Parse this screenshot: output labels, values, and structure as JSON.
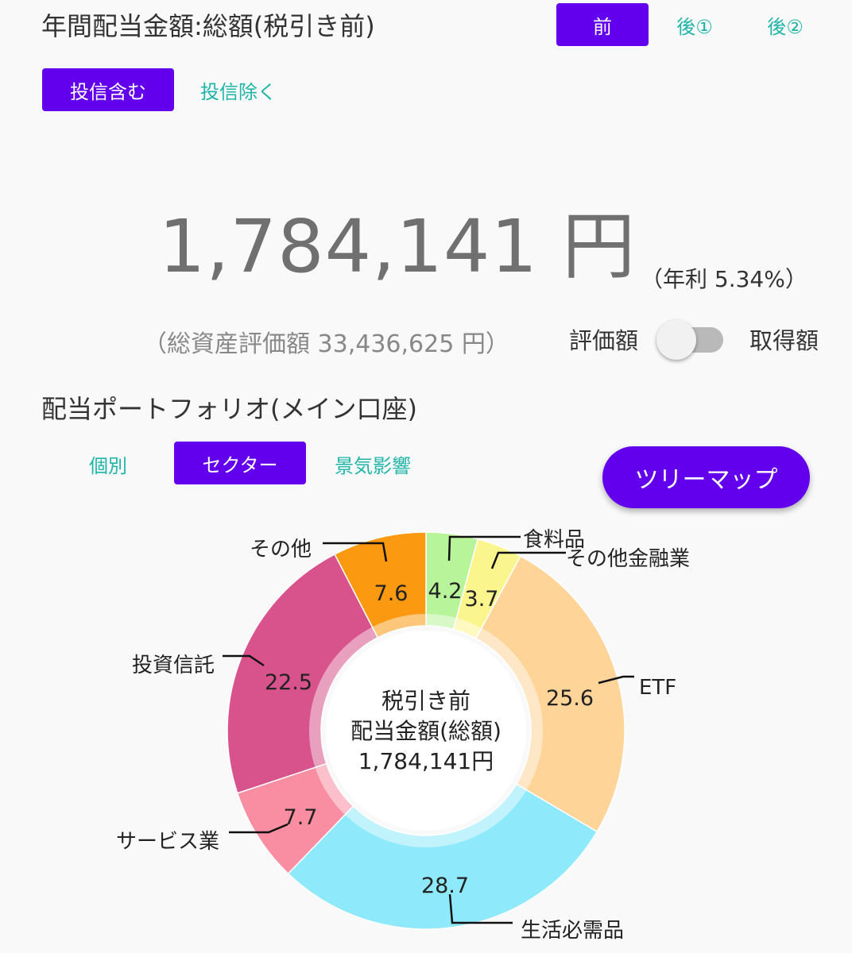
{
  "header": {
    "title": "年間配当金額:総額(税引き前)",
    "tax_tabs": [
      "前",
      "後①",
      "後②"
    ],
    "fund_tabs": [
      "投信含む",
      "投信除く"
    ]
  },
  "summary": {
    "amount": "1,784,141 円",
    "rate": "（年利 5.34%）",
    "total_assets": "（総資産評価額 33,436,625 円）",
    "toggle_left": "評価額",
    "toggle_right": "取得額"
  },
  "portfolio": {
    "title": "配当ポートフォリオ(メイン口座)",
    "view_tabs": [
      "個別",
      "セクター",
      "景気影響"
    ],
    "treemap_button": "ツリーマップ"
  },
  "chart_data": {
    "type": "pie",
    "donut": true,
    "center_text": [
      "税引き前",
      "配当金額(総額)",
      "1,784,141円"
    ],
    "categories": [
      "食料品",
      "その他金融業",
      "ETF",
      "生活必需品",
      "サービス業",
      "投資信託",
      "その他"
    ],
    "values": [
      4.2,
      3.7,
      25.6,
      28.7,
      7.7,
      22.5,
      7.6
    ],
    "value_labels": [
      "4.2",
      "3.7",
      "25.6",
      "28.7",
      "7.7",
      "22.5",
      "7.6"
    ],
    "colors": [
      "#b8f59a",
      "#fbf58e",
      "#fed498",
      "#8ee9fb",
      "#f98da2",
      "#d8528b",
      "#fb9910"
    ]
  },
  "colors": {
    "accent": "#6200ee",
    "text_button": "#1fb5a8"
  }
}
